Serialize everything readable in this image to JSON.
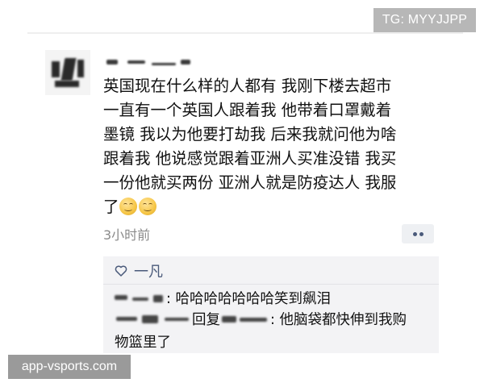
{
  "watermarks": {
    "top_right": "TG: MYYJJPP",
    "bottom_left": "app-vsports.com"
  },
  "post": {
    "lines": [
      "英国现在什么样的人都有 我刚下楼去超市",
      "一直有一个英国人跟着我 他带着口罩戴着",
      "墨镜 我以为他要打劫我 后来我就问他为啥",
      "跟着我 他说感觉跟着亚洲人买准没错 我买",
      "一份他就买两份 亚洲人就是防疫达人 我服",
      "了"
    ],
    "timestamp": "3小时前"
  },
  "likes": {
    "names": "一凡"
  },
  "comments": [
    {
      "text": ": 哈哈哈哈哈哈哈笑到飙泪"
    },
    {
      "reply_label": "回复",
      "text": ": 他脑袋都快伸到我购",
      "text_continued": "物篮里了"
    }
  ]
}
